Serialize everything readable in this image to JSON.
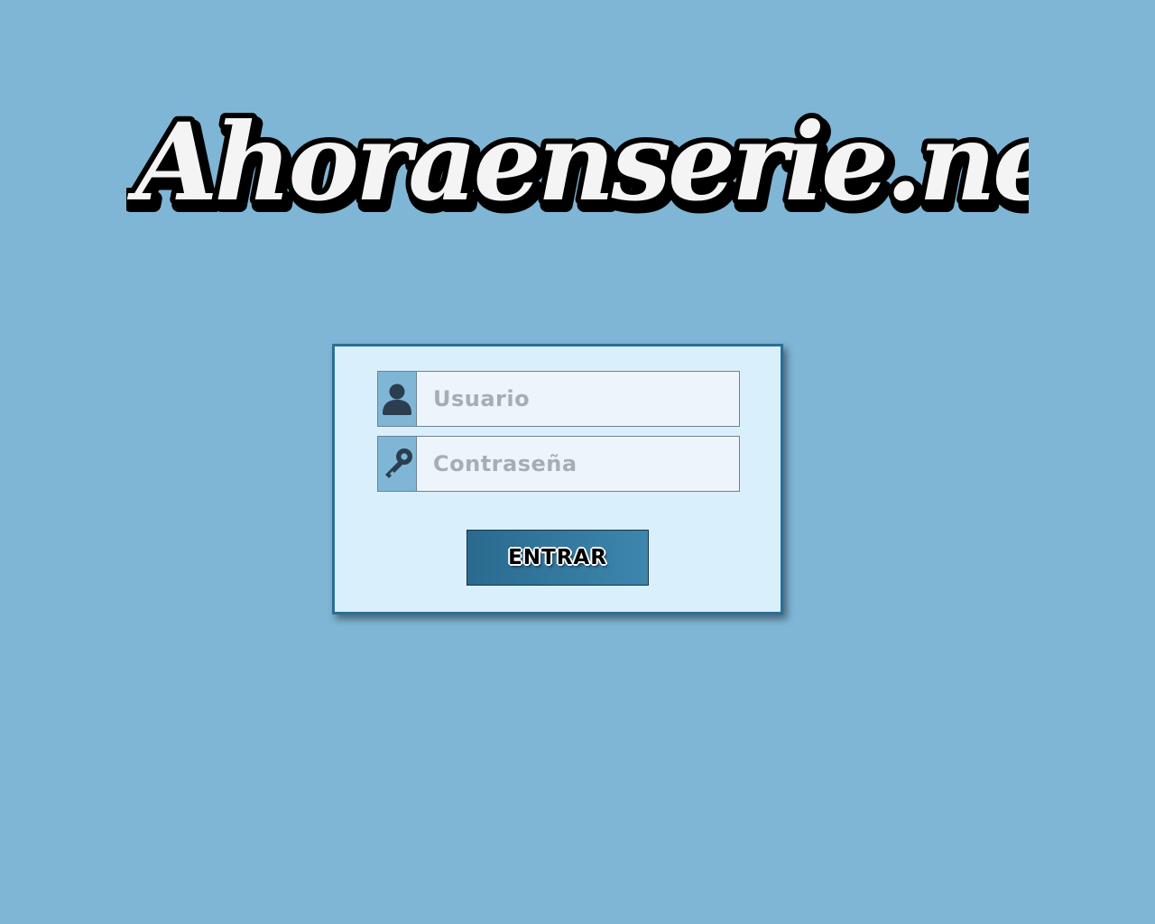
{
  "site": {
    "logo_text": "Ahoraenserie.net"
  },
  "login": {
    "username": {
      "placeholder": "Usuario",
      "value": "",
      "icon": "user-icon"
    },
    "password": {
      "placeholder": "Contraseña",
      "value": "",
      "icon": "key-icon"
    },
    "submit_label": "ENTRAR"
  },
  "colors": {
    "background": "#7fb6d6",
    "panel": "#d9effb",
    "panel_border": "#2c6e96",
    "icon_box": "#7fb6d6",
    "icon": "#2b3e4f",
    "button": "#2f7199"
  }
}
